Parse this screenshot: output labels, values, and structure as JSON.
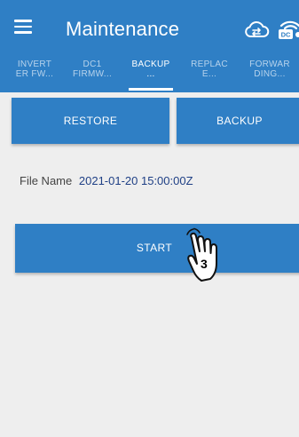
{
  "header": {
    "title": "Maintenance",
    "menu_icon": "hamburger-menu-icon",
    "cloud_icon": "cloud-sync-icon",
    "device_icon": "dc-wifi-icon",
    "device_icon_label": "DC",
    "accent_color": "#2f7fc5"
  },
  "tabs": [
    {
      "line1": "INVERT",
      "line2": "ER FW..."
    },
    {
      "line1": "DC1",
      "line2": "FIRMW..."
    },
    {
      "line1": "BACKUP",
      "line2": "..."
    },
    {
      "line1": "REPLAC",
      "line2": "E..."
    },
    {
      "line1": "FORWAR",
      "line2": "DING..."
    }
  ],
  "active_tab": "BACKUP",
  "actions": {
    "restore_label": "RESTORE",
    "backup_label": "BACKUP"
  },
  "file": {
    "label": "File Name",
    "value": "2021-01-20 15:00:00Z"
  },
  "start": {
    "label": "START"
  },
  "callout": {
    "icon": "tap-hand-icon",
    "step": "3"
  }
}
